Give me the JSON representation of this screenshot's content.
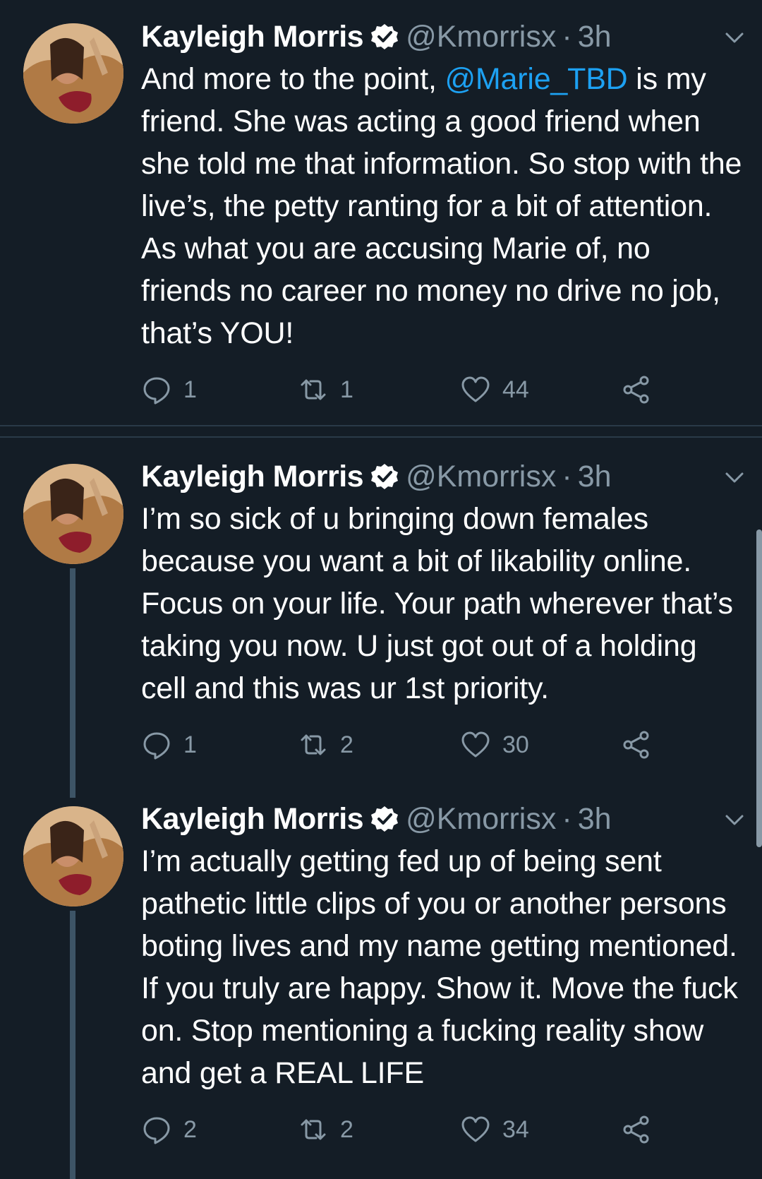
{
  "tweets": [
    {
      "name": "Kayleigh Morris",
      "handle": "@Kmorrisx",
      "dot": "·",
      "time": "3h",
      "text_before": "And more to the point, ",
      "mention": "@Marie_TBD",
      "text_after": " is my friend. She was acting a good friend when she told me that information. So stop with the live’s, the petty ranting for a bit of attention. As what you are accusing Marie of, no friends no career no money no drive no job, that’s YOU!",
      "replies": "1",
      "retweets": "1",
      "likes": "44"
    },
    {
      "name": "Kayleigh Morris",
      "handle": "@Kmorrisx",
      "dot": "·",
      "time": "3h",
      "text": "I’m so sick of u bringing down females because you want a bit of likability online. Focus on your life. Your path wherever that’s taking you now. U just got out of a holding cell and this was ur 1st priority.",
      "replies": "1",
      "retweets": "2",
      "likes": "30"
    },
    {
      "name": "Kayleigh Morris",
      "handle": "@Kmorrisx",
      "dot": "·",
      "time": "3h",
      "text": "I’m actually getting fed up of being sent pathetic little clips of you or another persons boting lives and my name getting mentioned. If you truly are happy. Show it. Move the fuck on. Stop mentioning a fucking reality show and get a REAL LIFE",
      "replies": "2",
      "retweets": "2",
      "likes": "34"
    }
  ],
  "colors": {
    "background": "#141d26",
    "secondary_text": "#8899a6",
    "link": "#1da1f2",
    "thread_line": "#3d5466"
  },
  "icons": [
    "verified-badge-icon",
    "chevron-down-icon",
    "reply-icon",
    "retweet-icon",
    "like-icon",
    "share-icon"
  ]
}
